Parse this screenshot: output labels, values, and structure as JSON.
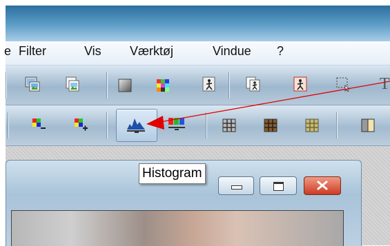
{
  "menu": {
    "items": [
      {
        "label": "e"
      },
      {
        "label": "Filter"
      },
      {
        "label": "Vis"
      },
      {
        "label": "Værktøj"
      },
      {
        "label": "Vindue"
      },
      {
        "label": "?"
      }
    ]
  },
  "toolbar1": {
    "icons": [
      "image-color-icon",
      "image-copy-icon",
      "gray-square-icon",
      "color-grid-icon",
      "figure-frame-icon",
      "figure-frame-copy-icon",
      "figure-frame-red-icon",
      "selection-icon"
    ],
    "partial_text": "T"
  },
  "toolbar2": {
    "icons": [
      "color-minus-icon",
      "color-plus-icon",
      "histogram-icon",
      "rgb-histogram-icon",
      "grid-gray-icon",
      "grid-brown-icon",
      "grid-olive-icon",
      "split-frame-icon"
    ],
    "active": "histogram-icon"
  },
  "tooltip": {
    "text": "Histogram"
  },
  "colors": {
    "annotation_arrow": "#e00000",
    "title_bar": "#4a8cbc",
    "close_button": "#d9442e"
  }
}
